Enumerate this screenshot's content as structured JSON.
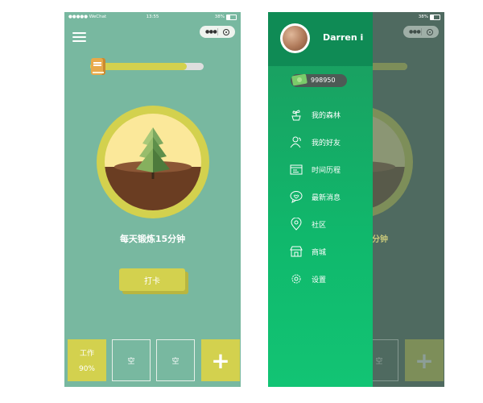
{
  "status_bar": {
    "carrier": "●●●●● WeChat",
    "time": "13:55",
    "battery": "38%"
  },
  "left": {
    "progress": 0.85,
    "task_title": "每天锻炼15分钟",
    "checkin_label": "打卡",
    "tiles": [
      {
        "line1": "工作",
        "line2": "90%"
      },
      {
        "line1": "空"
      },
      {
        "line1": "空"
      },
      {
        "line1": "+"
      }
    ]
  },
  "right": {
    "username": "Darren i",
    "coins": "998950",
    "menu": [
      {
        "label": "我的森林",
        "icon": "potted-plant-icon"
      },
      {
        "label": "我的好友",
        "icon": "friends-icon"
      },
      {
        "label": "时间历程",
        "icon": "timeline-icon"
      },
      {
        "label": "最新消息",
        "icon": "message-icon"
      },
      {
        "label": "社区",
        "icon": "location-pin-icon"
      },
      {
        "label": "商城",
        "icon": "shop-icon"
      },
      {
        "label": "设置",
        "icon": "gear-icon"
      }
    ],
    "bg_title_fragment": "分钟",
    "bg_tile": "空",
    "bg_add": "+"
  },
  "colors": {
    "teal_bg": "#78b8a0",
    "accent": "#d3d14e",
    "drawer_green": "#10b86c"
  }
}
